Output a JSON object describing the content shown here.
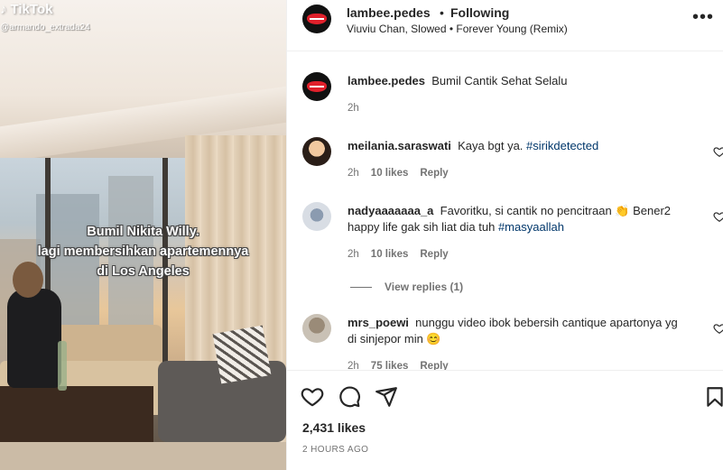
{
  "video": {
    "watermark": "TikTok",
    "tiktok_user": "@armando_extrada24",
    "caption_lines": [
      "Bumil Nikita Willy.",
      "lagi membersihkan apartemennya",
      "di Los Angeles"
    ]
  },
  "header": {
    "username": "lambee.pedes",
    "separator": "•",
    "follow_status": "Following",
    "audio": "Viuviu Chan, Slowed • Forever Young (Remix)",
    "more_icon": "more-horizontal-icon"
  },
  "post_caption": {
    "username": "lambee.pedes",
    "text": "Bumil Cantik Sehat Selalu",
    "time": "2h"
  },
  "comments": [
    {
      "username": "meilania.saraswati",
      "text": "Kaya bgt ya.",
      "hashtag": "#sirikdetected",
      "time": "2h",
      "likes": "10 likes",
      "reply": "Reply"
    },
    {
      "username": "nadyaaaaaaa_a",
      "text_line1": "Favoritku, si cantik no pencitraan 👏 Bener2",
      "text_line2": "happy life gak sih liat dia tuh",
      "hashtag": "#masyaallah",
      "time": "2h",
      "likes": "10 likes",
      "reply": "Reply",
      "view_replies": "View replies (1)"
    },
    {
      "username": "mrs_poewi",
      "text_line1": "nunggu video ibok bebersih cantique apartonya yg",
      "text_line2": "di sinjepor min 😊",
      "time": "2h",
      "likes": "75 likes",
      "reply": "Reply"
    }
  ],
  "actions": {
    "icons": [
      "heart-icon",
      "comment-icon",
      "share-icon",
      "bookmark-icon"
    ],
    "likes": "2,431 likes",
    "timestamp": "2 HOURS AGO"
  },
  "colors": {
    "brand_red": "#e0202b",
    "link_blue": "#00376b",
    "muted": "#737373"
  }
}
